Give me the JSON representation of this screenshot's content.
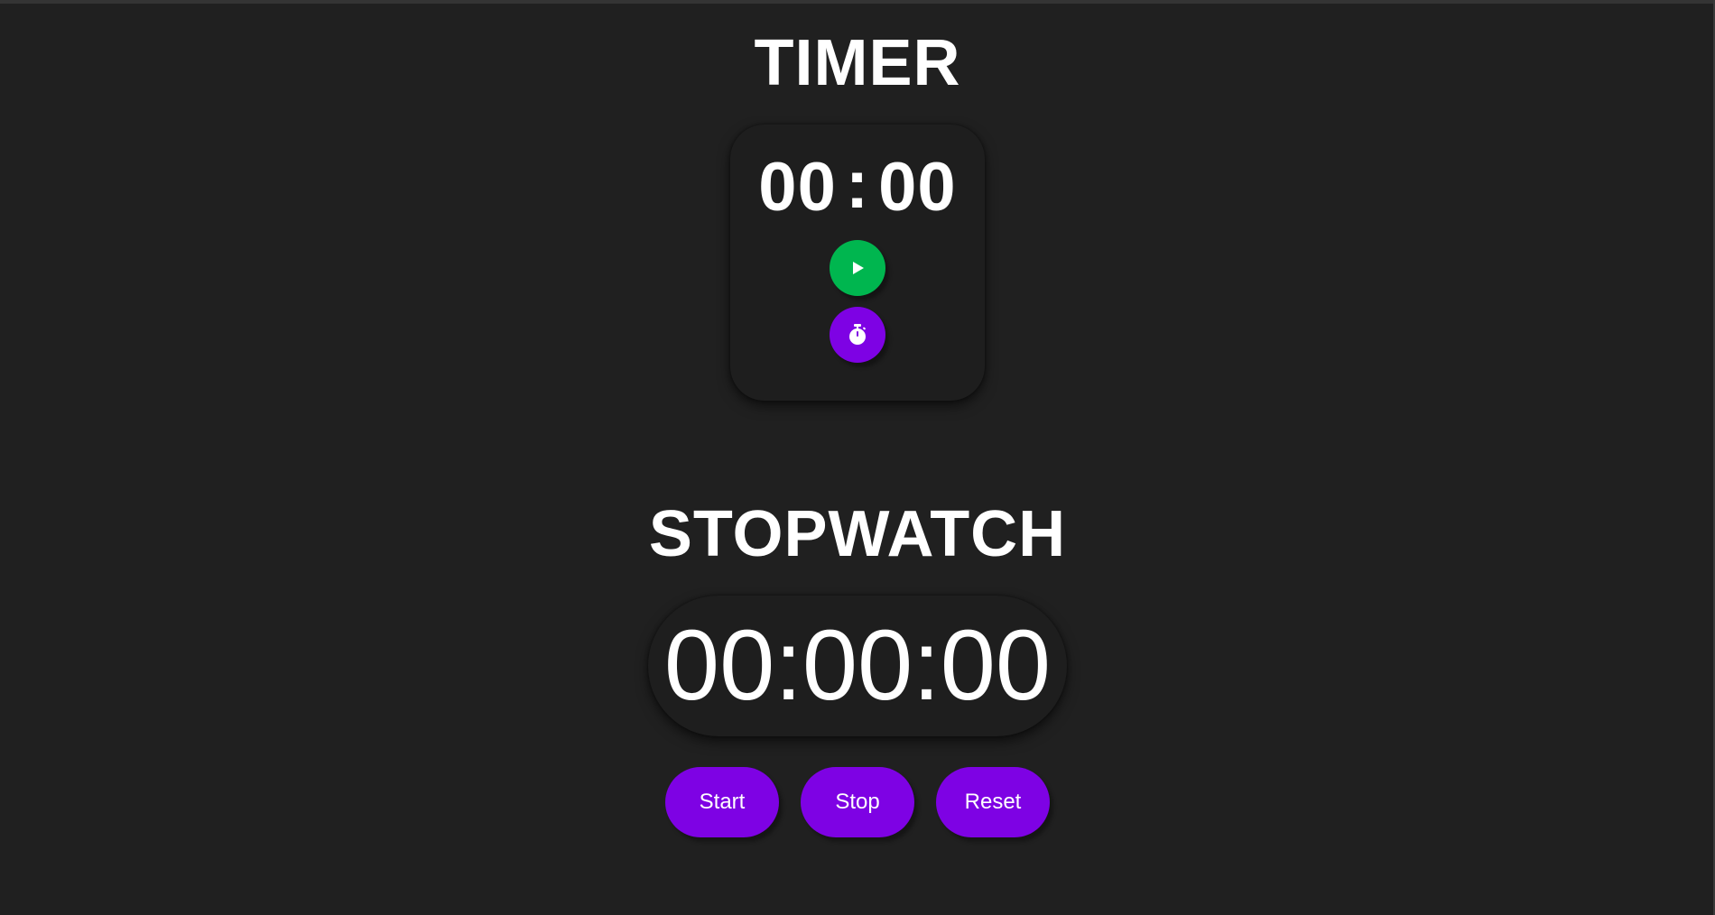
{
  "timer": {
    "title": "TIMER",
    "minutes": "00",
    "separator": ":",
    "seconds": "00",
    "play_icon": "play-icon",
    "set_icon": "stopwatch-icon"
  },
  "stopwatch": {
    "title": "STOPWATCH",
    "display": "00:00:00",
    "buttons": {
      "start": "Start",
      "stop": "Stop",
      "reset": "Reset"
    }
  },
  "colors": {
    "background": "#202020",
    "card": "#1e1e1e",
    "accent_purple": "#7e02e4",
    "accent_green": "#00b64f",
    "text": "#ffffff"
  }
}
